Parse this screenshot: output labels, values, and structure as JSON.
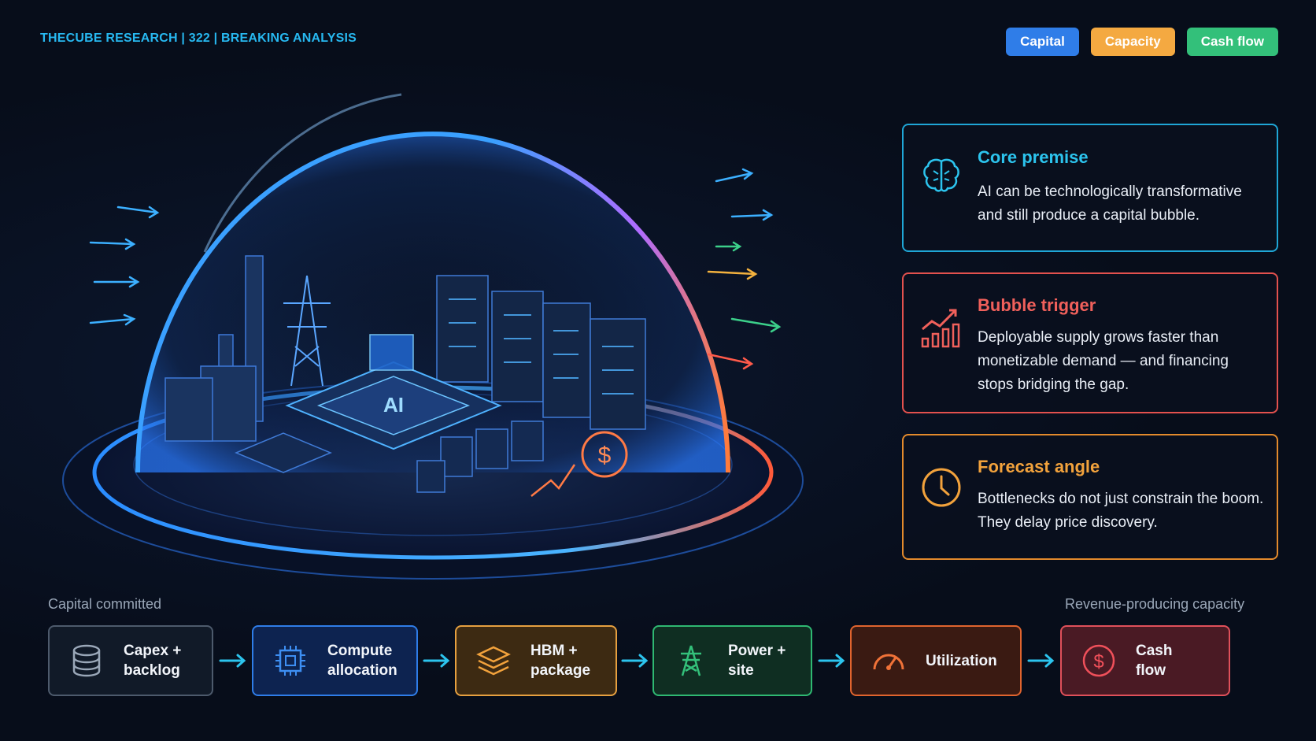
{
  "header": {
    "brand": "THECUBE RESEARCH | 322 | BREAKING ANALYSIS",
    "tags": [
      "Capital",
      "Capacity",
      "Cash flow"
    ]
  },
  "illustration": {
    "chip_label": "AI",
    "currency_symbol": "$"
  },
  "cards": [
    {
      "icon": "brain-icon",
      "title": "Core premise",
      "body": "AI can be technologically transformative and still produce a capital bubble.",
      "color": "#2cc4ee"
    },
    {
      "icon": "chart-up-icon",
      "title": "Bubble trigger",
      "body": "Deployable supply grows faster than monetizable demand — and financing stops bridging the gap.",
      "color": "#f0605b"
    },
    {
      "icon": "clock-icon",
      "title": "Forecast angle",
      "body": "Bottlenecks do not just constrain the boom. They delay price discovery.",
      "color": "#f2a23c"
    }
  ],
  "flow": {
    "left_label": "Capital committed",
    "right_label": "Revenue-producing capacity",
    "steps": [
      {
        "icon": "database-icon",
        "label": "Capex +\nbacklog"
      },
      {
        "icon": "cpu-icon",
        "label": "Compute\nallocation"
      },
      {
        "icon": "layers-icon",
        "label": "HBM +\npackage"
      },
      {
        "icon": "power-tower-icon",
        "label": "Power +\nsite"
      },
      {
        "icon": "gauge-icon",
        "label": "Utilization"
      },
      {
        "icon": "dollar-icon",
        "label": "Cash\nflow"
      }
    ]
  }
}
